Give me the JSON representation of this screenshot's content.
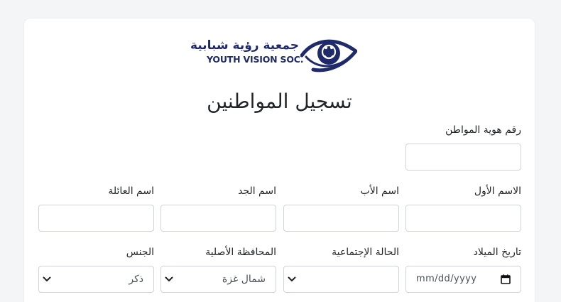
{
  "logo": {
    "arabic_name": "جمعية رؤية شبابية",
    "english_name": "YOUTH VISION SOC.",
    "brand_color": "#1f2a6b"
  },
  "form": {
    "title": "تسجيل المواطنين",
    "national_id": {
      "label": "رقم هوية المواطن",
      "value": ""
    },
    "first_name": {
      "label": "الاسم الأول",
      "value": ""
    },
    "father_name": {
      "label": "اسم الأب",
      "value": ""
    },
    "grandfather_name": {
      "label": "اسم الجد",
      "value": ""
    },
    "family_name": {
      "label": "اسم العائلة",
      "value": ""
    },
    "birth_date": {
      "label": "تاريخ الميلاد",
      "placeholder": "mm/dd/yyyy"
    },
    "marital_status": {
      "label": "الحالة الإجتماعية",
      "selected": ""
    },
    "governorate": {
      "label": "المحافظة الأصلية",
      "selected": "شمال غزة"
    },
    "gender": {
      "label": "الجنس",
      "selected": "ذكر"
    }
  },
  "icons": {
    "logo": "eye-logo-icon",
    "select_arrow": "chevron-down-icon",
    "date_picker": "calendar-icon"
  }
}
